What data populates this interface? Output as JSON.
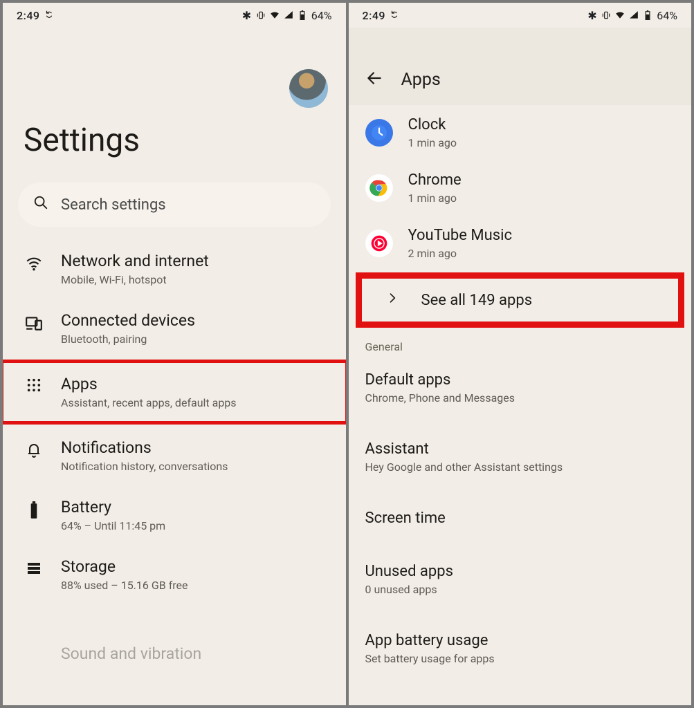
{
  "status": {
    "time": "2:49",
    "battery": "64%"
  },
  "left": {
    "title": "Settings",
    "search_placeholder": "Search settings",
    "items": [
      {
        "label": "Network and internet",
        "sub": "Mobile, Wi-Fi, hotspot"
      },
      {
        "label": "Connected devices",
        "sub": "Bluetooth, pairing"
      },
      {
        "label": "Apps",
        "sub": "Assistant, recent apps, default apps"
      },
      {
        "label": "Notifications",
        "sub": "Notification history, conversations"
      },
      {
        "label": "Battery",
        "sub": "64% – Until 11:45 pm"
      },
      {
        "label": "Storage",
        "sub": "88% used – 15.16 GB free"
      }
    ],
    "cutoff_label": "Sound and vibration"
  },
  "right": {
    "header": "Apps",
    "recent": [
      {
        "label": "Clock",
        "sub": "1 min ago"
      },
      {
        "label": "Chrome",
        "sub": "1 min ago"
      },
      {
        "label": "YouTube Music",
        "sub": "2 min ago"
      }
    ],
    "see_all": "See all 149 apps",
    "section": "General",
    "general": [
      {
        "label": "Default apps",
        "sub": "Chrome, Phone and Messages"
      },
      {
        "label": "Assistant",
        "sub": "Hey Google and other Assistant settings"
      },
      {
        "label": "Screen time",
        "sub": ""
      },
      {
        "label": "Unused apps",
        "sub": "0 unused apps"
      },
      {
        "label": "App battery usage",
        "sub": "Set battery usage for apps"
      }
    ]
  }
}
